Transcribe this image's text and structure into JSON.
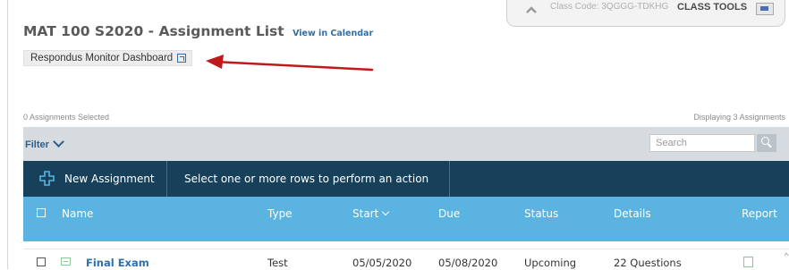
{
  "class_tools": {
    "class_code": "Class Code: 3QGGG-TDKHG",
    "label": "CLASS TOOLS",
    "icon": "class-tools-icon"
  },
  "page": {
    "title": "MAT 100 S2020 - Assignment List",
    "view_calendar": "View in Calendar",
    "respondus_button": "Respondus Monitor Dashboard"
  },
  "annotation": {
    "arrow_color": "#c0191c"
  },
  "status": {
    "selected": "0 Assignments Selected",
    "displaying": "Displaying 3 Assignments"
  },
  "filter": {
    "label": "Filter",
    "search_placeholder": "Search"
  },
  "actions": {
    "new_assignment": "New Assignment",
    "hint": "Select one or more rows to perform an action"
  },
  "table": {
    "columns": [
      "Name",
      "Type",
      "Start",
      "Due",
      "Status",
      "Details",
      "Report"
    ],
    "rows": [
      {
        "name": "Final Exam",
        "type": "Test",
        "start": "05/05/2020",
        "due": "05/08/2020",
        "status": "Upcoming",
        "details": "22 Questions"
      }
    ]
  },
  "colors": {
    "action_bar": "#17405b",
    "header_row": "#5ab3e0",
    "filter_bar": "#d5dbdf",
    "link": "#2f6fa8"
  }
}
